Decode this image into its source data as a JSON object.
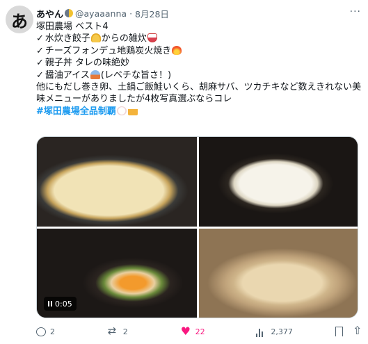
{
  "author": {
    "avatar_char": "あ",
    "name": "あやん",
    "handle": "@ayaaanna",
    "separator": "·",
    "date": "8月28日"
  },
  "post": {
    "line1": "塚田農場 ベスト4",
    "check": "✓",
    "item1_a": "水炊き餃子",
    "item1_b": "からの雑炊",
    "item2": "チーズフォンデュ地鶏炭火焼き",
    "item3": "親子丼 タレの味絶妙",
    "item4_a": "醤油アイス",
    "item4_b": "(レベチな旨さ！)",
    "paragraph": "他にもだし巻き卵、土鍋ご飯鮭いくら、胡麻サバ、ツカチキなど数えきれない美味メニューがありましたが4枚写真選ぶならコレ",
    "hashtag": "#塚田農場全品制覇"
  },
  "media": {
    "video_duration": "0:05"
  },
  "actions": {
    "replies": "2",
    "reposts": "2",
    "likes": "22",
    "views": "2,377",
    "like_color": "#f91880",
    "hashtag_color": "#1d9bf0"
  }
}
